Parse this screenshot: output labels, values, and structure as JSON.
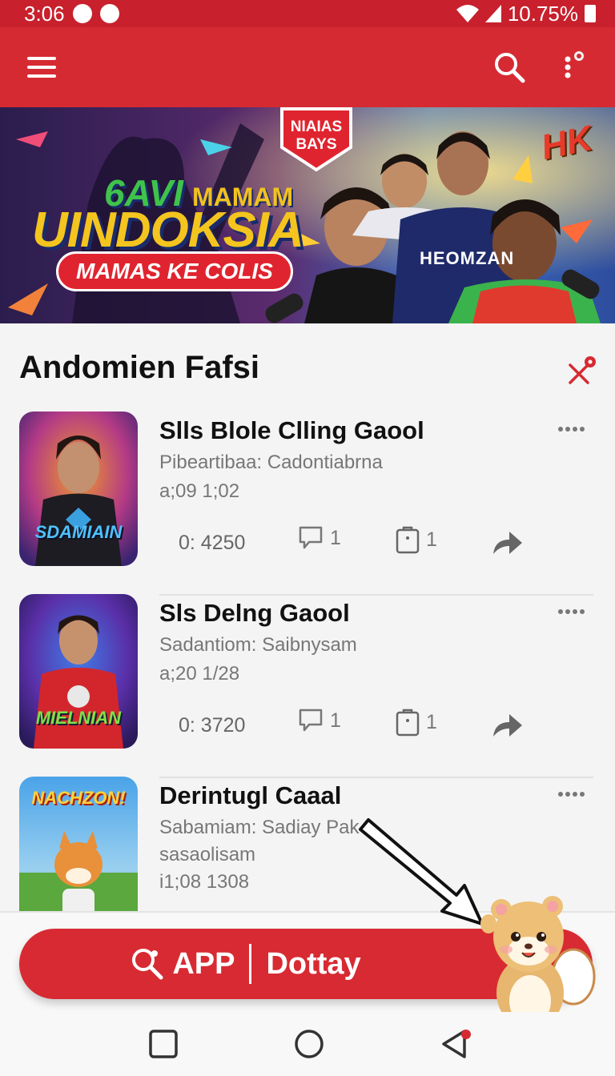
{
  "status_bar": {
    "time": "3:06",
    "battery": "10.75%"
  },
  "app_bar": {
    "menu_icon": "menu-icon",
    "search_icon": "search-icon",
    "more_icon": "more-vert-icon"
  },
  "banner": {
    "title_line1": "6AVI",
    "title_line1b": "MAMAM",
    "title_line2": "UINDOKSIA",
    "pill": "MAMAS KE COLIS",
    "badge_line1": "NIAIAS",
    "badge_line2": "BAYS",
    "hk": "HK",
    "jersey": "HEOMZAN"
  },
  "section": {
    "title": "Andomien Fafsi"
  },
  "cards": [
    {
      "title": "Slls Blole Clling Gaool",
      "subtitle": "Pibeartibaa: Cadontiabrna",
      "date": "a;09 1;02",
      "views": "0: 4250",
      "comments": "1",
      "saves": "1",
      "thumb_label": "SDAMIAIN"
    },
    {
      "title": "Sls Delng Gaool",
      "subtitle": "Sadantiom: Saibnysam",
      "date": "a;20 1/28",
      "views": "0: 3720",
      "comments": "1",
      "saves": "1",
      "thumb_label": "MIELNIAN"
    },
    {
      "title": "Derintugl Caaal",
      "subtitle": "Sabamiam: Sadiay Pak",
      "subtitle2": "sasaolisam",
      "date": "i1;08 1308",
      "thumb_label": "NACHZON!"
    }
  ],
  "cta": {
    "app_label": "APP",
    "label": "Dottay"
  },
  "colors": {
    "primary": "#d62a33",
    "status": "#c8202c",
    "text_muted": "#777777"
  }
}
